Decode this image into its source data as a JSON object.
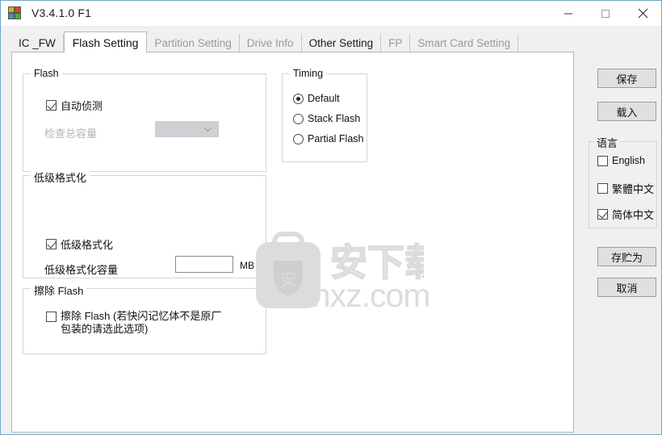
{
  "window": {
    "title": "V3.4.1.0 F1",
    "icon": "app-blocks-icon",
    "minimize_label": "─",
    "maximize_label": "□",
    "close_label": "✕"
  },
  "tabs": [
    {
      "label": "IC _FW",
      "state": "enabled"
    },
    {
      "label": "Flash Setting",
      "state": "selected"
    },
    {
      "label": "Partition Setting",
      "state": "disabled"
    },
    {
      "label": "Drive Info",
      "state": "disabled"
    },
    {
      "label": "Other Setting",
      "state": "enabled"
    },
    {
      "label": "FP",
      "state": "disabled"
    },
    {
      "label": "Smart Card Setting",
      "state": "disabled"
    }
  ],
  "flash_group": {
    "legend": "Flash",
    "auto_detect": {
      "label": "自动侦测",
      "checked": true
    },
    "check_capacity_label": "检查总容量",
    "capacity_combo": {
      "value": "",
      "enabled": false
    }
  },
  "timing_group": {
    "legend": "Timing",
    "options": [
      {
        "label": "Default",
        "selected": true
      },
      {
        "label": "Stack Flash",
        "selected": false
      },
      {
        "label": "Partial Flash",
        "selected": false
      }
    ]
  },
  "low_level_format_group": {
    "legend": "低级格式化",
    "checkbox": {
      "label": "低级格式化",
      "checked": true
    },
    "capacity_label": "低级格式化容量",
    "capacity_value": "",
    "unit": "MB"
  },
  "erase_flash_group": {
    "legend": "擦除 Flash",
    "checkbox": {
      "label": "擦除 Flash (若快闪记忆体不是原厂包装的请选此选项)",
      "checked": false
    }
  },
  "sidebar": {
    "save_label": "保存",
    "load_label": "载入",
    "save_as_label": "存贮为",
    "cancel_label": "取消",
    "language_group": {
      "legend": "语言",
      "options": [
        {
          "label": "English",
          "checked": false
        },
        {
          "label": "繁體中文",
          "checked": false
        },
        {
          "label": "简体中文",
          "checked": true
        }
      ]
    }
  },
  "watermark": {
    "logo_char": "安",
    "chinese": "安下载",
    "domain": "anxz.com"
  },
  "colors": {
    "window_border": "#6ea5c8",
    "panel_bg": "#ffffff",
    "chrome_bg": "#f0eff1",
    "button_bg": "#e0e0e0",
    "groupbox_border": "#d6d6d6",
    "disabled_text": "#9a9a9a",
    "watermark": "#dcdcdc"
  }
}
